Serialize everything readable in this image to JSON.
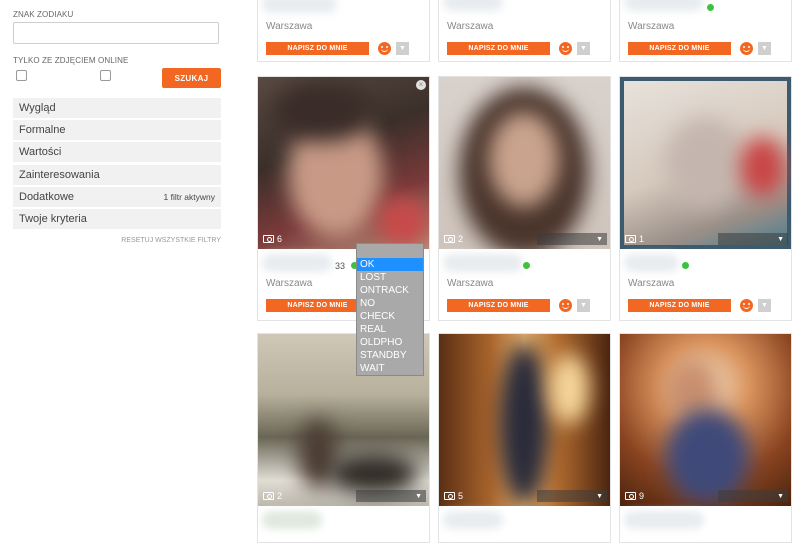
{
  "sidebar": {
    "zodiac_label": "ZNAK ZODIAKU",
    "photo_label": "TYLKO ZE ZDJĘCIEM",
    "online_label": "ONLINE",
    "search_label": "SZUKAJ",
    "filters": [
      {
        "label": "Wygląd",
        "note": ""
      },
      {
        "label": "Formalne",
        "note": ""
      },
      {
        "label": "Wartości",
        "note": ""
      },
      {
        "label": "Zainteresowania",
        "note": ""
      },
      {
        "label": "Dodatkowe",
        "note": "1 filtr aktywny"
      },
      {
        "label": "Twoje kryteria",
        "note": ""
      }
    ],
    "reset_label": "RESETUJ WSZYSTKIE FILTRY"
  },
  "cards_top": [
    {
      "city": "Warszawa",
      "write": "NAPISZ DO MNIE"
    },
    {
      "city": "Warszawa",
      "write": "NAPISZ DO MNIE"
    },
    {
      "city": "Warszawa",
      "write": "NAPISZ DO MNIE"
    }
  ],
  "cards_mid": [
    {
      "count": "6",
      "age": "33",
      "city": "Warszawa",
      "write": "NAPISZ DO MNIE"
    },
    {
      "count": "2",
      "age": "",
      "city": "Warszawa",
      "write": "NAPISZ DO MNIE"
    },
    {
      "count": "1",
      "age": "",
      "city": "Warszawa",
      "write": "NAPISZ DO MNIE"
    }
  ],
  "cards_bottom": [
    {
      "count": "2"
    },
    {
      "count": "5"
    },
    {
      "count": "9"
    }
  ],
  "dropdown": {
    "options": [
      "OK",
      "LOST",
      "ONTRACK",
      "NO",
      "CHECK",
      "REAL",
      "OLDPHO",
      "STANDBY",
      "WAIT"
    ],
    "selected": "OK"
  },
  "icons": {
    "smile": "smile-icon",
    "more": "chevron-down-icon",
    "camera": "camera-icon",
    "close": "close-icon"
  },
  "colors": {
    "accent": "#f26722",
    "online": "#3bc43b",
    "dropdown_selected": "#1e90ff"
  }
}
